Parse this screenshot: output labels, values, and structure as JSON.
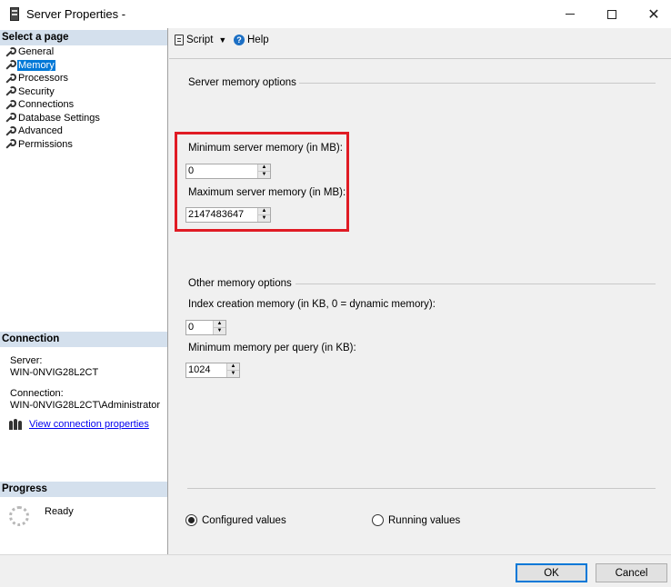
{
  "window": {
    "title": "Server Properties -"
  },
  "left": {
    "select_page_header": "Select a page",
    "pages": [
      {
        "label": "General"
      },
      {
        "label": "Memory"
      },
      {
        "label": "Processors"
      },
      {
        "label": "Security"
      },
      {
        "label": "Connections"
      },
      {
        "label": "Database Settings"
      },
      {
        "label": "Advanced"
      },
      {
        "label": "Permissions"
      }
    ],
    "selected_page": "Memory",
    "connection_header": "Connection",
    "server_label": "Server:",
    "server_value": "WIN-0NVIG28L2CT",
    "connection_label": "Connection:",
    "connection_value": "WIN-0NVIG28L2CT\\Administrator",
    "view_connection_link": "View connection properties",
    "progress_header": "Progress",
    "progress_status": "Ready"
  },
  "toolbar": {
    "script_label": "Script",
    "help_label": "Help"
  },
  "server_memory": {
    "group_title": "Server memory options",
    "min_label": "Minimum server memory (in MB):",
    "min_value": "0",
    "max_label": "Maximum server memory (in MB):",
    "max_value": "2147483647"
  },
  "other_memory": {
    "group_title": "Other memory options",
    "index_label": "Index creation memory (in KB, 0 = dynamic memory):",
    "index_value": "0",
    "min_query_label": "Minimum memory per query (in KB):",
    "min_query_value": "1024"
  },
  "values_mode": {
    "configured_label": "Configured values",
    "running_label": "Running values",
    "selected": "configured"
  },
  "footer": {
    "ok_label": "OK",
    "cancel_label": "Cancel"
  },
  "colors": {
    "highlight_border": "#e01b24",
    "selection": "#0078d7",
    "section_header_bg": "#d4e0ed",
    "link": "#0000ee"
  }
}
